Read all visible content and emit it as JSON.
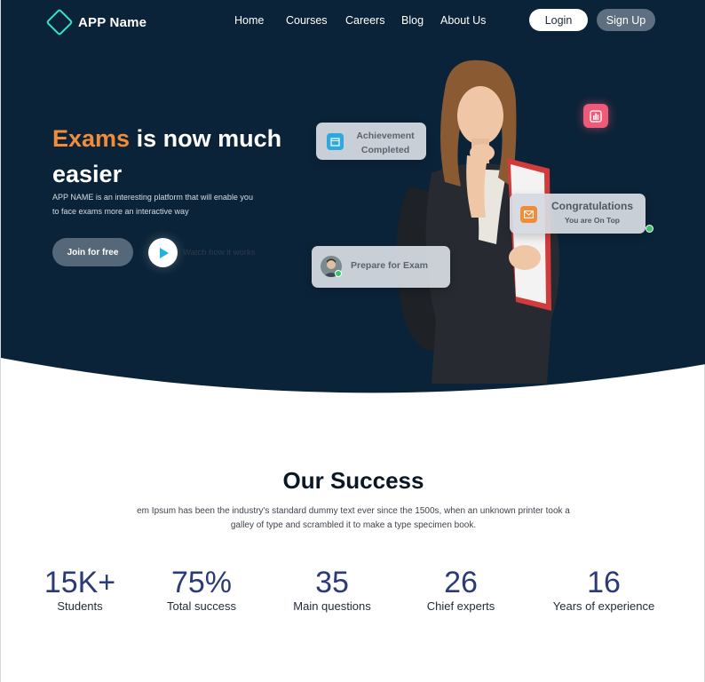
{
  "brand": {
    "name": "APP Name"
  },
  "nav": {
    "items": [
      "Home",
      "Courses",
      "Careers",
      "Blog",
      "About Us"
    ],
    "login_label": "Login",
    "signup_label": "Sign Up"
  },
  "hero": {
    "headline_accent": "Exams",
    "headline_rest": " is now much easier",
    "description": "APP NAME is an interesting platform that will enable you to face exams more an interactive way",
    "join_label": "Join for free",
    "watch_label": "Watch how it works",
    "cards": {
      "achievement": "Achievement Completed",
      "congrats_title": "Congratulations",
      "congrats_sub": "You are On Top",
      "prepare": "Prepare for Exam"
    }
  },
  "success": {
    "title": "Our Success",
    "description": "em Ipsum has been the industry's standard dummy text ever since the 1500s, when an unknown printer took a galley of type and scrambled it to make a type specimen book.",
    "stats": [
      {
        "value": "15K+",
        "label": "Students"
      },
      {
        "value": "75%",
        "label": "Total success"
      },
      {
        "value": "35",
        "label": "Main questions"
      },
      {
        "value": "26",
        "label": "Chief experts"
      },
      {
        "value": "16",
        "label": "Years of experience"
      }
    ]
  },
  "colors": {
    "hero_bg": "#0b2338",
    "accent_orange": "#f28c38",
    "stat_blue": "#2c3a78",
    "play_cyan": "#1fb3e0"
  },
  "icons": {
    "logo": "diamond-logo-icon",
    "play": "play-icon",
    "calendar": "calendar-icon",
    "mail": "mail-icon",
    "chart": "bar-chart-icon"
  }
}
